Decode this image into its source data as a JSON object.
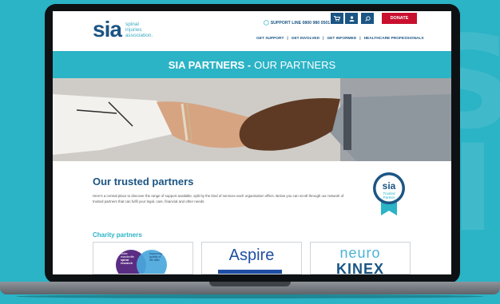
{
  "header": {
    "logo": {
      "mark": "sia",
      "line1": "spinal",
      "line2": "injuries",
      "line3": "association."
    },
    "support_line": "SUPPORT LINE 0800 980 0501",
    "donate_label": "DONATE",
    "nav": [
      "GET SUPPORT",
      "GET INVOLVED",
      "GET INFORMED",
      "HEALTHCARE PROFESSIONALS"
    ],
    "nav_separator": "|"
  },
  "banner": {
    "bold": "SIA PARTNERS -",
    "light": "OUR PARTNERS"
  },
  "content": {
    "title": "Our trusted partners",
    "intro": "Here's a central place to discover the range of support available, split by the kind of services each organisation offers. Below you can scroll through our network of trusted partners that can fulfil your legal, care, financial and other needs.",
    "badge": {
      "mark": "sia",
      "line1": "Trusted",
      "line2": "Partner"
    },
    "charity_title": "Charity partners",
    "cards": [
      {
        "line1": "stoke",
        "line2": "mandeville",
        "line3": "spinal",
        "line4": "research",
        "right1": "Improving",
        "right2": "quality of",
        "right3": "life after"
      },
      {
        "word": "Aspire"
      },
      {
        "word1": "neuro",
        "word2": "KINEX"
      }
    ]
  },
  "colors": {
    "teal": "#2bb3c6",
    "navy": "#1b5584",
    "red": "#c8102e"
  },
  "icons": [
    "cart-icon",
    "user-icon",
    "search-icon",
    "speech-bubble-icon"
  ]
}
